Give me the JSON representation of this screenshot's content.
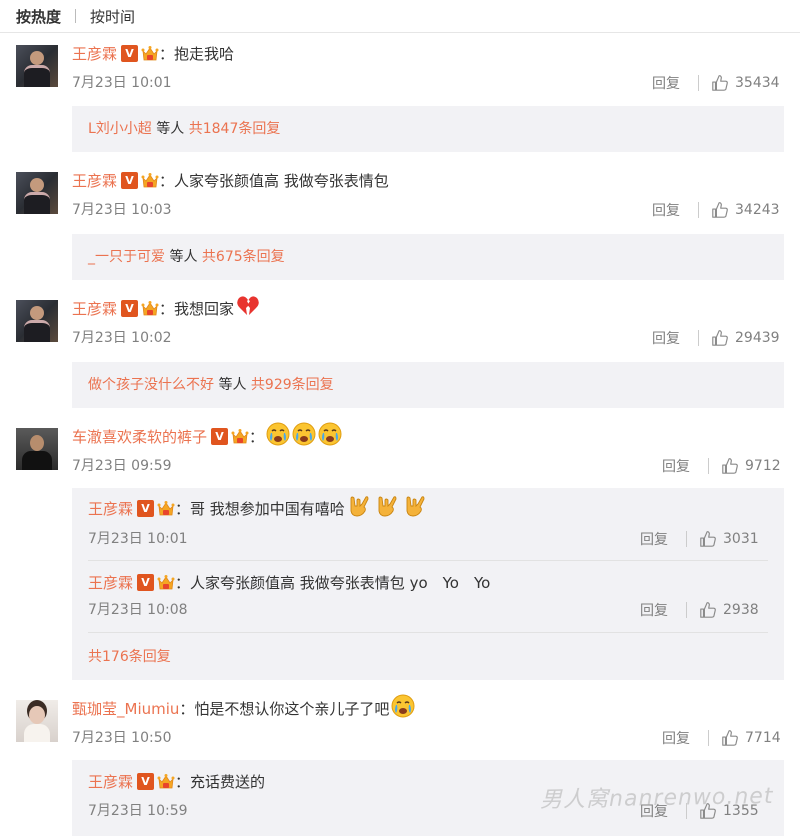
{
  "tabs": {
    "hot": "按热度",
    "time": "按时间"
  },
  "colors": {
    "link": "#eb7350",
    "meta": "#808080",
    "reply_bg": "#f2f2f5",
    "vip_badge": "#e0551f"
  },
  "labels": {
    "reply": "回复"
  },
  "comments": [
    {
      "user": "王彦霖",
      "sep": "：",
      "text": "抱走我哈",
      "time": "7月23日 10:01",
      "likes": "35434",
      "more": {
        "user": "L刘小小超",
        "mid": "等人",
        "count": "共1847条回复"
      }
    },
    {
      "user": "王彦霖",
      "sep": "：",
      "text": "人家夸张颜值高 我做夸张表情包",
      "time": "7月23日 10:03",
      "likes": "34243",
      "more": {
        "user": "_一只于可爱",
        "mid": "等人",
        "count": "共675条回复"
      }
    },
    {
      "user": "王彦霖",
      "sep": "：",
      "text": "我想回家",
      "emoji": "broken-heart-icon",
      "time": "7月23日 10:02",
      "likes": "29439",
      "more": {
        "user": "做个孩子没什么不好",
        "mid": "等人",
        "count": "共929条回复"
      }
    },
    {
      "user": "车澈喜欢柔软的裤子",
      "sep": "：",
      "emoji": "crying-face-icon x3",
      "time": "7月23日 09:59",
      "likes": "9712",
      "replies": [
        {
          "user": "王彦霖",
          "sep": "：",
          "text": "哥 我想参加中国有嘻哈",
          "emoji": "rock-hand-icon x3",
          "time": "7月23日 10:01",
          "likes": "3031"
        },
        {
          "user": "王彦霖",
          "sep": "：",
          "text": "人家夸张颜值高 我做夸张表情包 yo　Yo　Yo",
          "time": "7月23日 10:08",
          "likes": "2938"
        }
      ],
      "more": {
        "count": "共176条回复"
      }
    },
    {
      "user": "甄珈莹_Miumiu",
      "sep": "：",
      "text": "怕是不想认你这个亲儿子了吧",
      "emoji": "crying-face-icon",
      "time": "7月23日 10:50",
      "likes": "7714",
      "replies": [
        {
          "user": "王彦霖",
          "sep": "：",
          "text": "充话费送的",
          "time": "7月23日 10:59",
          "likes": "1355"
        }
      ]
    }
  ],
  "watermark": "男人窝nanrenwo.net"
}
